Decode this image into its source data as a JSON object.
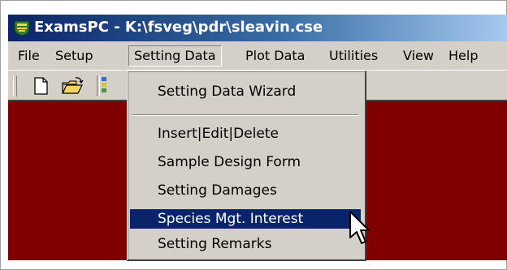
{
  "window": {
    "title": "ExamsPC - K:\\fsveg\\pdr\\sleavin.cse",
    "app_icon": "examspc-shield-icon"
  },
  "menubar": {
    "items": [
      {
        "label": "File"
      },
      {
        "label": "Setup"
      },
      {
        "label": "Setting Data",
        "open": true
      },
      {
        "label": "Plot Data"
      },
      {
        "label": "Utilities"
      },
      {
        "label": "View"
      },
      {
        "label": "Help"
      }
    ]
  },
  "toolbar": {
    "buttons": [
      {
        "icon": "new-document-icon"
      },
      {
        "icon": "open-folder-icon"
      },
      {
        "icon": "toolbar-color-icon"
      }
    ]
  },
  "dropdown": {
    "items": [
      {
        "label": "Setting Data Wizard"
      },
      {
        "label": "Insert|Edit|Delete"
      },
      {
        "label": "Sample Design Form"
      },
      {
        "label": "Setting Damages"
      },
      {
        "label": "Species Mgt. Interest",
        "highlighted": true
      },
      {
        "label": "Setting Remarks"
      }
    ]
  },
  "colors": {
    "title_gradient_start": "#0a246a",
    "title_gradient_end": "#a6caf0",
    "chrome": "#d4d0c8",
    "client_background": "#800000",
    "highlight": "#0a246a"
  }
}
